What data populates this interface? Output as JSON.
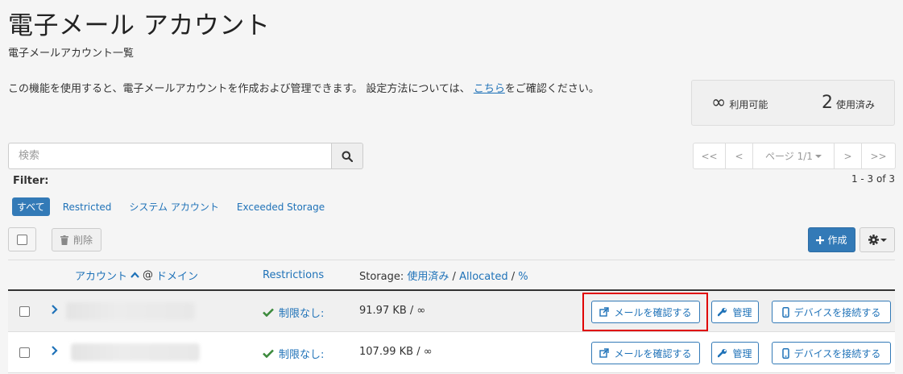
{
  "header": {
    "title": "電子メール アカウント",
    "subtitle": "電子メールアカウント一覧"
  },
  "intro": {
    "text_before": "この機能を使用すると、電子メールアカウントを作成および管理できます。 設定方法については、",
    "link_text": "こちら",
    "text_after": "をご確認ください。"
  },
  "stats": {
    "available_value": "∞",
    "available_label": "利用可能",
    "used_value": "2",
    "used_label": "使用済み"
  },
  "search": {
    "placeholder": "検索"
  },
  "pagination": {
    "first": "<<",
    "prev": "<",
    "page_label": "ページ 1/1",
    "next": ">",
    "last": ">>",
    "range": "1 - 3 of 3"
  },
  "filter": {
    "label": "Filter:",
    "options": [
      "すべて",
      "Restricted",
      "システム アカウント",
      "Exceeded Storage"
    ]
  },
  "toolbar": {
    "delete_label": "削除",
    "create_label": "作成"
  },
  "table": {
    "headers": {
      "account": "アカウント",
      "at_sign": "@",
      "domain": "ドメイン",
      "restrictions": "Restrictions",
      "storage_prefix": "Storage:",
      "storage_used": "使用済み",
      "slash": "/",
      "storage_allocated": "Allocated",
      "storage_percent": "%"
    },
    "rows": [
      {
        "restriction": "制限なし:",
        "usage": "91.97 KB / ∞"
      },
      {
        "restriction": "制限なし:",
        "usage": "107.99 KB / ∞"
      }
    ],
    "actions": {
      "check_email": "メールを確認する",
      "manage": "管理",
      "connect_devices": "デバイスを接続する"
    }
  },
  "colors": {
    "primary": "#337ab7",
    "link": "#1f72b8",
    "success": "#3c8a3c",
    "highlight": "#e00000"
  }
}
